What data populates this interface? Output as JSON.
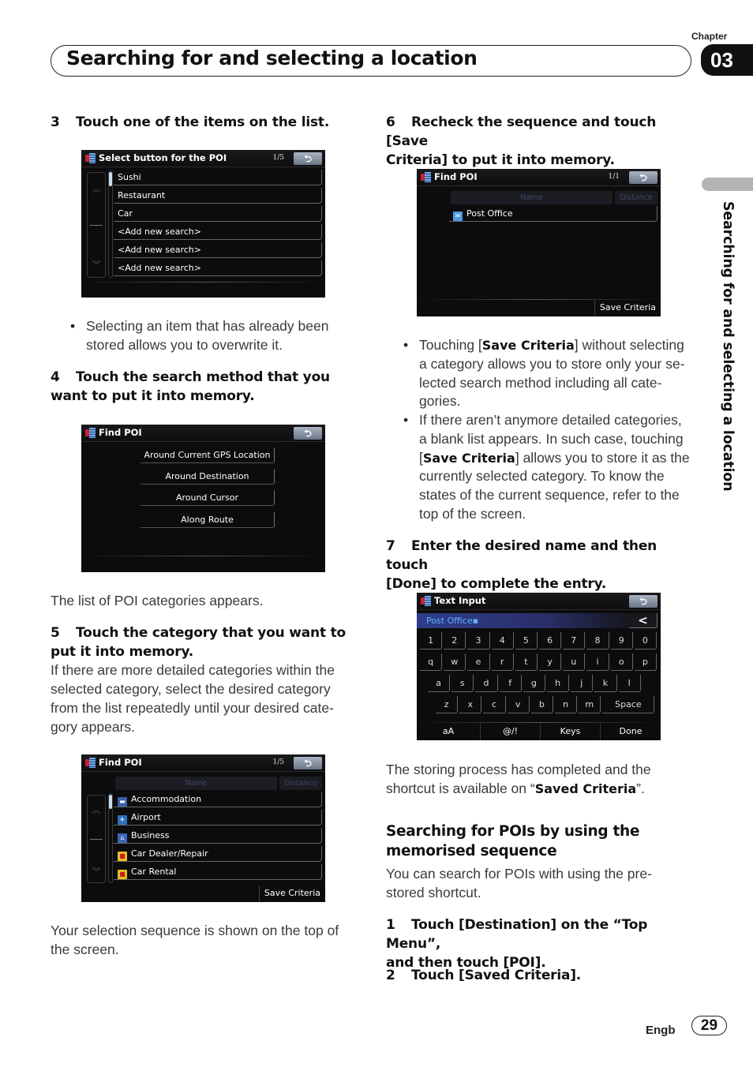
{
  "header": {
    "chapter_label": "Chapter",
    "chapter_number": "03",
    "title": "Searching for and selecting a location"
  },
  "side_tab": {
    "text": "Searching for and selecting a location"
  },
  "left_column": {
    "step3": {
      "num": "3",
      "text": "Touch one of the items on the list."
    },
    "screen1": {
      "title": "Select button for the POI",
      "page": "1/5",
      "back_icon": "back-arrow-icon",
      "items": [
        "Sushi",
        "Restaurant",
        "Car",
        "<Add new search>",
        "<Add new search>",
        "<Add new search>"
      ]
    },
    "bullet1": "Selecting an item that has already been stored allows you to overwrite it.",
    "step4": {
      "num": "4",
      "line1": "Touch the search method that you",
      "line2": "want to put it into memory."
    },
    "screen2": {
      "title": "Find POI",
      "back_icon": "back-arrow-icon",
      "methods": [
        "Around Current GPS Location",
        "Around Destination",
        "Around Cursor",
        "Along Route"
      ]
    },
    "after_screen2": "The list of POI categories appears.",
    "step5": {
      "num": "5",
      "line1": "Touch the category that you want to",
      "line2": "put it into memory."
    },
    "step5_body": "If there are more detailed categories within the selected category, select the desired category from the list repeatedly until your desired cate-gory appears.",
    "screen3": {
      "title": "Find POI",
      "page": "1/5",
      "col_name": "Name",
      "col_distance": "Distance",
      "items": [
        {
          "label": "Accommodation",
          "icon": "bed-icon",
          "color": "#3b5fa8"
        },
        {
          "label": "Airport",
          "icon": "airplane-icon",
          "color": "#2b6fbf"
        },
        {
          "label": "Business",
          "icon": "building-icon",
          "color": "#3b66b8"
        },
        {
          "label": "Car Dealer/Repair",
          "icon": "car-icon",
          "color": "#e8c21c"
        },
        {
          "label": "Car Rental",
          "icon": "car-icon",
          "color": "#e8c21c"
        }
      ],
      "save_criteria": "Save Criteria"
    },
    "after_screen3": "Your selection sequence is shown on the top of the screen."
  },
  "right_column": {
    "step6": {
      "num": "6",
      "line1": "Recheck the sequence and touch [Save",
      "line2": "Criteria] to put it into memory."
    },
    "screen4": {
      "title": "Find POI",
      "page": "1/1",
      "col_name": "Name",
      "col_distance": "Distance",
      "items": [
        {
          "label": "Post Office",
          "icon": "mail-icon",
          "color": "#4a9be0"
        }
      ],
      "save_criteria": "Save Criteria"
    },
    "bullets": [
      {
        "pre": "Touching [",
        "bold": "Save Criteria",
        "post": "] without selecting a category allows you to store only your se-lected search method including all cate-gories."
      },
      {
        "pre": "If there aren’t anymore detailed categories, a blank list appears. In such case, touching [",
        "bold": "Save Criteria",
        "post": "] allows you to store it as the currently selected category. To know the states of the current sequence, refer to the top of the screen."
      }
    ],
    "step7": {
      "num": "7",
      "line1": "Enter the desired name and then touch",
      "line2": "[Done] to complete the entry."
    },
    "screen5": {
      "title": "Text Input",
      "input_value": "Post Office",
      "backspace": "<",
      "row1": [
        "1",
        "2",
        "3",
        "4",
        "5",
        "6",
        "7",
        "8",
        "9",
        "0"
      ],
      "row2": [
        "q",
        "w",
        "e",
        "r",
        "t",
        "y",
        "u",
        "i",
        "o",
        "p"
      ],
      "row3": [
        "a",
        "s",
        "d",
        "f",
        "g",
        "h",
        "j",
        "k",
        "l"
      ],
      "row4": [
        "z",
        "x",
        "c",
        "v",
        "b",
        "n",
        "m"
      ],
      "space": "Space",
      "func_keys": [
        "aA",
        "@/!",
        "Keys",
        "Done"
      ]
    },
    "after_screen5": {
      "pre": "The storing process has completed and the shortcut is available on “",
      "bold": "Saved Criteria",
      "post": "”."
    },
    "subhead": {
      "line1": "Searching for POIs by using the",
      "line2": "memorised sequence"
    },
    "subhead_body": "You can search for POIs with using the pre-stored shortcut.",
    "stepA": {
      "num": "1",
      "line1": "Touch [Destination] on the “Top Menu”,",
      "line2": "and then touch [POI]."
    },
    "stepB": {
      "num": "2",
      "text": "Touch [Saved Criteria]."
    }
  },
  "footer": {
    "lang": "Engb",
    "page": "29"
  }
}
